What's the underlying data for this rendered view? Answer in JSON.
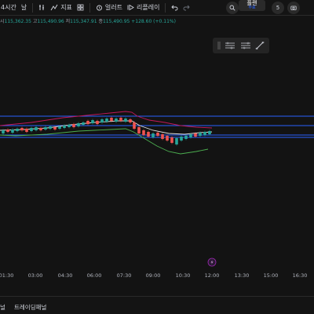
{
  "toolbar": {
    "interval": "4시간",
    "candle_type_label": "날",
    "indicators_label": "지표",
    "alert_label": "얼러트",
    "replay_label": "리플레이",
    "plan_label": "플랜",
    "plan_sub": "무료",
    "notifications_count": "5",
    "icons": [
      "add-icon",
      "bar-style-icon",
      "indicators-icon",
      "layout-grid-icon",
      "alert-icon",
      "replay-icon",
      "undo-icon",
      "redo-icon",
      "search-icon",
      "camera-icon"
    ]
  },
  "ohlc": {
    "open_prefix": "시",
    "open": "115,362.35",
    "high_prefix": "고",
    "high": "115,490.96",
    "low_prefix": "저",
    "low": "115,347.91",
    "close_prefix": "종",
    "close": "115,490.95",
    "change": "+128.60 (+0.11%)"
  },
  "float_tools": {
    "icons": [
      "drag-handle-icon",
      "channel-settings-icon",
      "channel-style-icon",
      "trend-line-icon"
    ]
  },
  "time_axis": {
    "labels": [
      "01:30",
      "03:00",
      "04:30",
      "06:00",
      "07:30",
      "09:00",
      "10:30",
      "12:00",
      "13:30",
      "15:00",
      "16:30"
    ]
  },
  "event_marker": {
    "icon": "lightning-icon",
    "color": "#9c27b0"
  },
  "bottom_bar": {
    "left_label": "널",
    "panel_label": "트레이딩패널"
  },
  "colors": {
    "background": "#131313",
    "up": "#26a69a",
    "down": "#ef5350",
    "channel": "#2962ff",
    "upper_band": "#c2185b",
    "lower_band": "#4caf50",
    "basis": "#e0e0e0"
  }
}
